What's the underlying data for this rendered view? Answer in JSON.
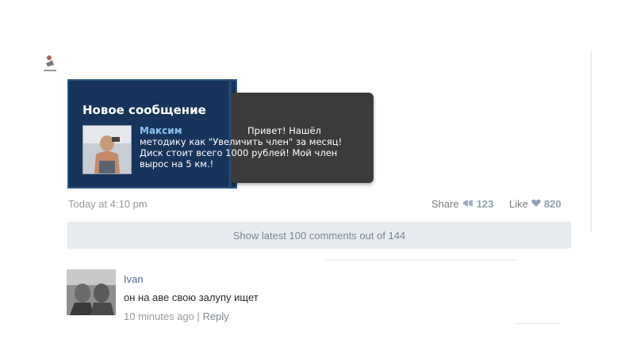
{
  "notification": {
    "title": "Новое сообщение",
    "sender": "Максим",
    "message": "Привет! Нашёл методику как \"Увеличить член\" за месяц! Диск стоит всего 1000 рублей! Мой член вырос на 5 км.!"
  },
  "post": {
    "timestamp": "Today at 4:10 pm",
    "share_label": "Share",
    "share_count": "123",
    "like_label": "Like",
    "like_count": "820",
    "show_comments": "Show latest 100 comments out of 144"
  },
  "comment": {
    "author": "Ivan",
    "text": "он на аве свою залупу ищет",
    "time": "10 minutes ago",
    "separator": "|",
    "reply_label": "Reply"
  },
  "colors": {
    "notification_blue": "#17355a",
    "notification_dark": "#3b3b3b",
    "link_blue": "#4a6a8e",
    "count_blue": "#8fa1b3"
  }
}
